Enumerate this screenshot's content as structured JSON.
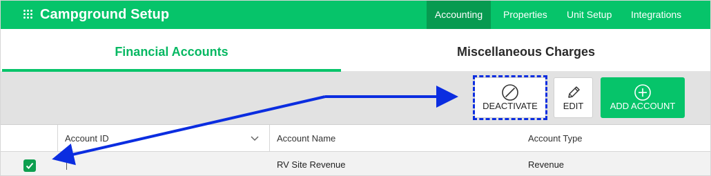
{
  "header": {
    "app_icon": "grid-dots-icon",
    "title": "Campground Setup",
    "nav": [
      "Accounting",
      "Properties",
      "Unit Setup",
      "Integrations"
    ],
    "active_nav": "Accounting"
  },
  "tabs": {
    "items": [
      "Financial Accounts",
      "Miscellaneous Charges"
    ],
    "active": "Financial Accounts"
  },
  "toolbar": {
    "deactivate_label": "DEACTIVATE",
    "deactivate_icon": "circle-slash-icon",
    "edit_label": "EDIT",
    "edit_icon": "pencil-icon",
    "add_label": "ADD ACCOUNT",
    "add_icon": "circle-plus-icon"
  },
  "table": {
    "columns": [
      "Account ID",
      "Account Name",
      "Account Type"
    ],
    "sort_icon": "chevron-down-icon",
    "rows": [
      {
        "checked": true,
        "account_id": "",
        "account_name": "RV Site Revenue",
        "account_type": "Revenue"
      }
    ]
  },
  "colors": {
    "brand_green": "#06c46a",
    "active_nav_green": "#079a50",
    "annotation_blue": "#0b2de0"
  }
}
